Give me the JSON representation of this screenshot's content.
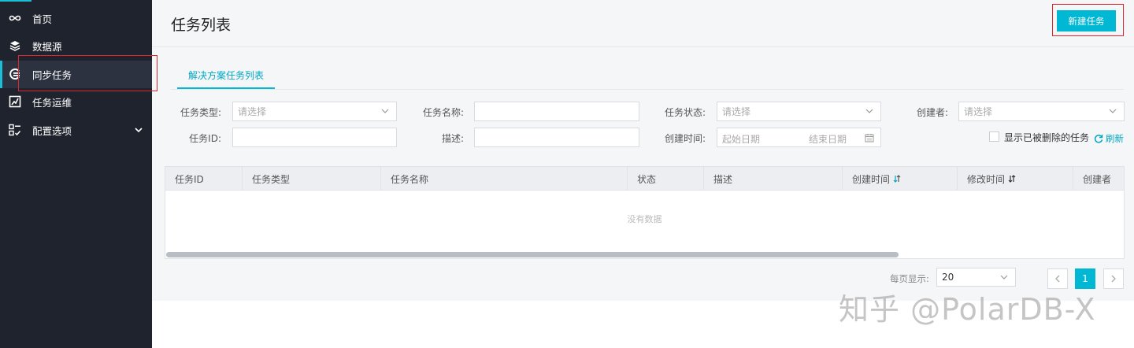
{
  "sidebar": {
    "items": [
      {
        "label": "首页",
        "icon": "infinity-icon"
      },
      {
        "label": "数据源",
        "icon": "layers-icon"
      },
      {
        "label": "同步任务",
        "icon": "sync-icon"
      },
      {
        "label": "任务运维",
        "icon": "ops-icon"
      },
      {
        "label": "配置选项",
        "icon": "config-icon"
      }
    ]
  },
  "header": {
    "title": "任务列表",
    "new_task_label": "新建任务"
  },
  "tabs": [
    {
      "label": "解决方案任务列表"
    }
  ],
  "filters": {
    "task_type": {
      "label": "任务类型:",
      "placeholder": "请选择"
    },
    "task_name": {
      "label": "任务名称:",
      "value": ""
    },
    "task_status": {
      "label": "任务状态:",
      "placeholder": "请选择"
    },
    "creator": {
      "label": "创建者:",
      "placeholder": "请选择"
    },
    "task_id": {
      "label": "任务ID:",
      "value": ""
    },
    "description": {
      "label": "描述:",
      "value": ""
    },
    "created_time": {
      "label": "创建时间:",
      "start_placeholder": "起始日期",
      "end_placeholder": "结束日期"
    },
    "show_deleted_label": "显示已被删除的任务",
    "refresh_label": "刷新"
  },
  "table": {
    "columns": [
      "任务ID",
      "任务类型",
      "任务名称",
      "状态",
      "描述",
      "创建时间",
      "修改时间",
      "创建者"
    ],
    "empty_text": "没有数据"
  },
  "pagination": {
    "per_page_label": "每页显示:",
    "per_page_value": "20",
    "current_page": "1"
  },
  "watermark": "知乎 @PolarDB-X",
  "colors": {
    "accent": "#00b8d4",
    "sidebar_bg": "#1f232d",
    "highlight_box": "#e0242b"
  }
}
